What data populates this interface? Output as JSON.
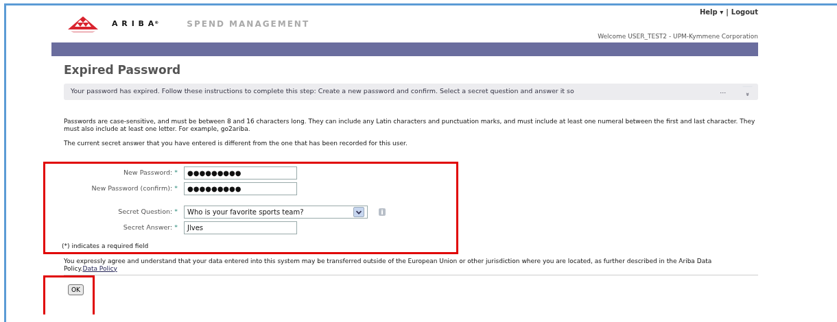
{
  "header": {
    "brand": "A R I B A",
    "brand_mark": "®",
    "product": "SPEND MANAGEMENT",
    "links": [
      {
        "label": "Help",
        "caret": "▾"
      },
      {
        "label": "Logout"
      }
    ],
    "link_separator": "|",
    "welcome": "Welcome USER_TEST2 - UPM-Kymmene Corporation"
  },
  "page": {
    "title": "Expired Password",
    "instructions": {
      "text": "Your password has expired.  Follow these instructions to complete this step: Create a new password and confirm. Select a secret question and answer it so",
      "more": "...",
      "expand": "»",
      "expanded": false
    },
    "rules": "Passwords are case-sensitive, and must be between 8 and 16 characters long. They can include any Latin characters and punctuation marks, and must include at least one numeral between the first and last character. They must also include at least one letter. For example, go2ariba.",
    "notice": "The current secret answer that you have entered is different from the one that has been recorded for this user.",
    "form": {
      "highlighted": true,
      "fields": [
        {
          "kind": "text",
          "label": "New Password:",
          "required_mark": "*",
          "value": "●●●●●●●●●"
        },
        {
          "kind": "text",
          "label": "New Password (confirm):",
          "required_mark": "*",
          "value": "●●●●●●●●●"
        },
        {
          "kind": "select",
          "label": "Secret Question:",
          "required_mark": "*",
          "value": "Who is your favorite sports team?"
        },
        {
          "kind": "text",
          "label": "Secret Answer:",
          "required_mark": "*",
          "value": "Jlves"
        }
      ],
      "required_note": "(*) indicates a required field"
    },
    "agreement": "You expressly agree and understand that your data entered into this system may be transferred outside of the European Union or other jurisdiction where you are located, as further described in the Ariba Data Policy.",
    "agreement_link": "Data Policy",
    "ok_button": {
      "label": "OK",
      "highlighted": true
    }
  }
}
